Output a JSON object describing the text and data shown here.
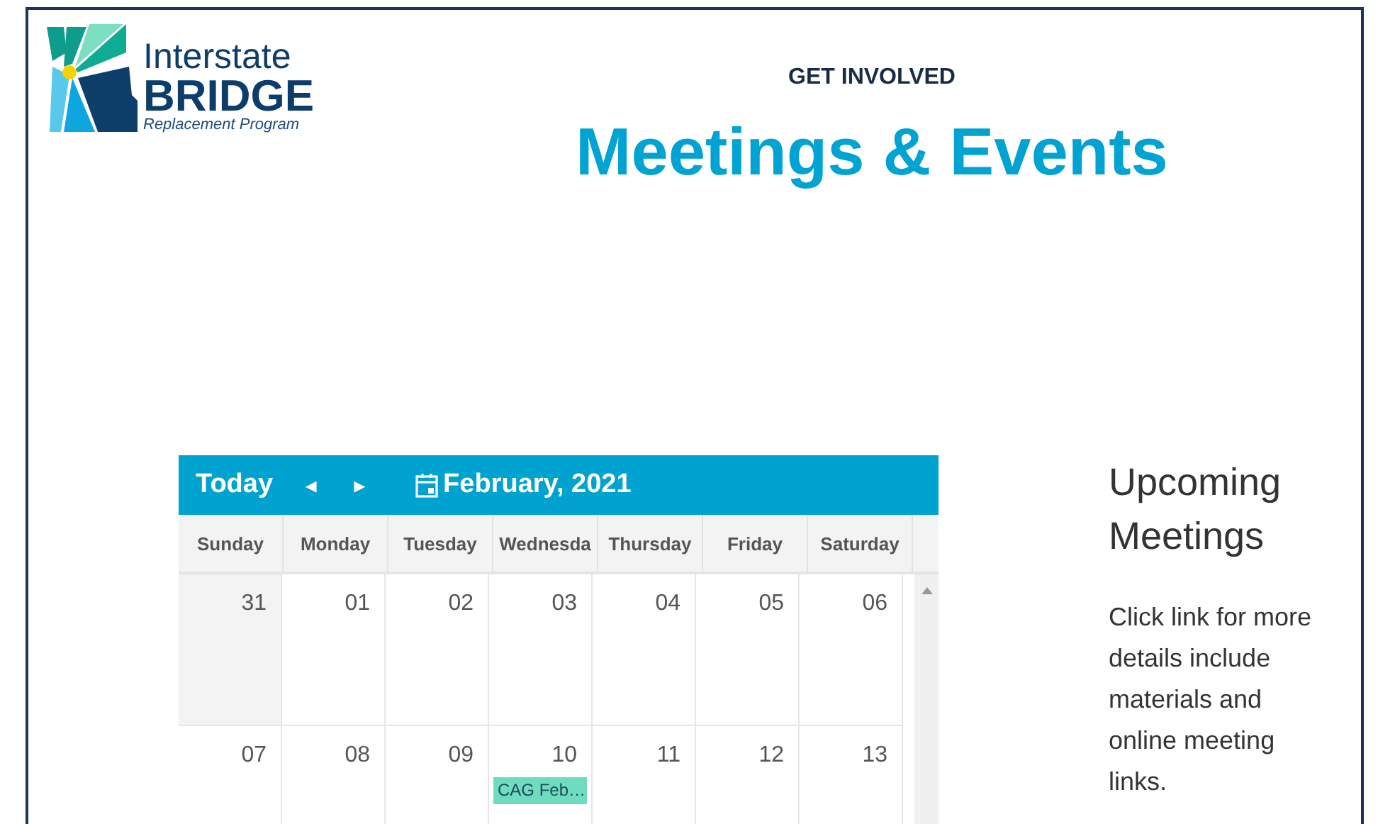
{
  "logo": {
    "line1": "Interstate",
    "line2": "BRIDGE",
    "line3": "Replacement Program"
  },
  "header": {
    "eyebrow": "GET INVOLVED",
    "title": "Meetings & Events"
  },
  "calendar": {
    "today": "Today",
    "prev": "◂",
    "next": "▸",
    "month": "February, 2021",
    "weekdays": [
      "Sunday",
      "Monday",
      "Tuesday",
      "Wednesda",
      "Thursday",
      "Friday",
      "Saturday"
    ],
    "weeks": [
      [
        {
          "day": "31",
          "other_month": true
        },
        {
          "day": "01",
          "other_month": false
        },
        {
          "day": "02",
          "other_month": false
        },
        {
          "day": "03",
          "other_month": false
        },
        {
          "day": "04",
          "other_month": false
        },
        {
          "day": "05",
          "other_month": false
        },
        {
          "day": "06",
          "other_month": false
        }
      ],
      [
        {
          "day": "07",
          "other_month": false
        },
        {
          "day": "08",
          "other_month": false
        },
        {
          "day": "09",
          "other_month": false
        },
        {
          "day": "10",
          "other_month": false,
          "events": [
            {
              "title": "CAG Feb…",
              "color": "#6fdcc0"
            }
          ]
        },
        {
          "day": "11",
          "other_month": false
        },
        {
          "day": "12",
          "other_month": false
        },
        {
          "day": "13",
          "other_month": false
        }
      ]
    ]
  },
  "sidebar": {
    "heading": "Upcoming Meetings",
    "text": "Click link for more details include materials and online meeting links."
  }
}
